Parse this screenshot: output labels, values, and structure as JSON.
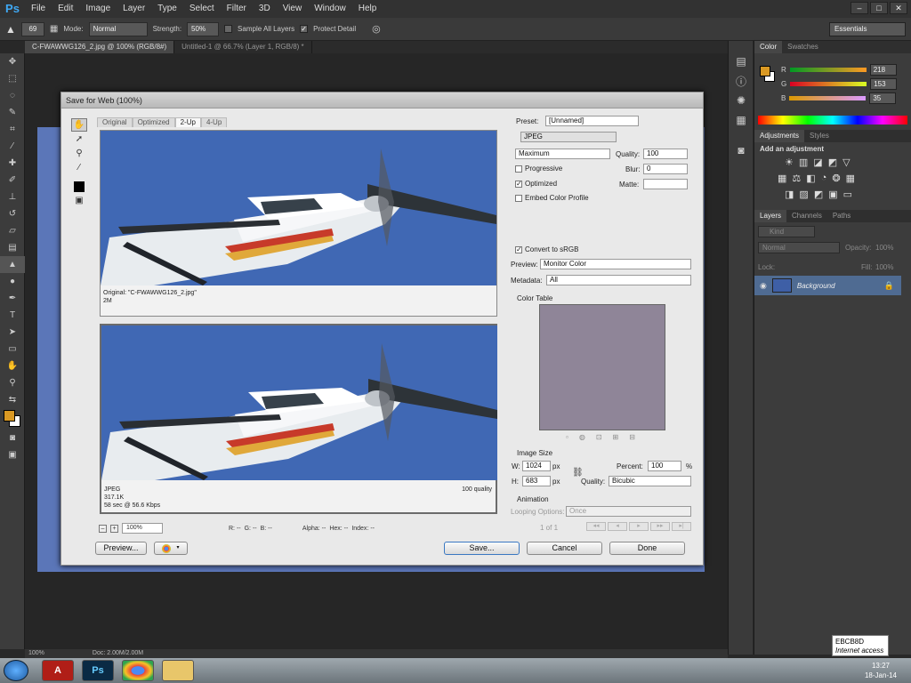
{
  "app": {
    "logo": "Ps"
  },
  "menu": [
    "File",
    "Edit",
    "Image",
    "Layer",
    "Type",
    "Select",
    "Filter",
    "3D",
    "View",
    "Window",
    "Help"
  ],
  "window_controls": [
    "–",
    "□",
    "✕"
  ],
  "options_bar": {
    "brush_size": "69",
    "mode_label": "Mode:",
    "mode_value": "Normal",
    "strength_label": "Strength:",
    "strength_value": "50%",
    "sample_all_layers": "Sample All Layers",
    "protect_detail": "Protect Detail",
    "workspace": "Essentials"
  },
  "doc_tabs": [
    {
      "label": "C-FWAWWG126_2.jpg @ 100% (RGB/8#)",
      "active": true
    },
    {
      "label": "Untitled-1 @ 66.7% (Layer 1, RGB/8) *",
      "active": false
    }
  ],
  "status_bar": {
    "zoom": "100%",
    "doc": "Doc: 2.00M/2.00M"
  },
  "color_panel": {
    "tabs": [
      "Color",
      "Swatches"
    ],
    "r_label": "R",
    "r_value": "218",
    "g_label": "G",
    "g_value": "153",
    "b_label": "B",
    "b_value": "35",
    "foreground_color": "#da9923"
  },
  "adjustments_panel": {
    "tabs": [
      "Adjustments",
      "Styles"
    ],
    "heading": "Add an adjustment"
  },
  "layers_panel": {
    "tabs": [
      "Layers",
      "Channels",
      "Paths"
    ],
    "kind": "Kind",
    "blend_mode": "Normal",
    "opacity_label": "Opacity:",
    "opacity_value": "100%",
    "lock_label": "Lock:",
    "fill_label": "Fill:",
    "fill_value": "100%",
    "layer_name": "Background"
  },
  "dialog": {
    "title": "Save for Web (100%)",
    "view_tabs": [
      "Original",
      "Optimized",
      "2-Up",
      "4-Up"
    ],
    "original_info": {
      "line1": "Original: \"C-FWAWWG126_2.jpg\"",
      "line2": "2M"
    },
    "optimized_info": {
      "format": "JPEG",
      "size": "317.1K",
      "time": "58 sec @ 56.6 Kbps",
      "quality": "100 quality"
    },
    "zoom": "100%",
    "readouts": {
      "r": "R: --",
      "g": "G: --",
      "b": "B: --",
      "alpha": "Alpha: --",
      "hex": "Hex: --",
      "index": "Index: --"
    },
    "preset_label": "Preset:",
    "preset_value": "[Unnamed]",
    "format_value": "JPEG",
    "compression_value": "Maximum",
    "quality_label": "Quality:",
    "quality_value": "100",
    "blur_label": "Blur:",
    "blur_value": "0",
    "matte_label": "Matte:",
    "progressive": "Progressive",
    "optimized": "Optimized",
    "embed_profile": "Embed Color Profile",
    "convert_srgb": "Convert to sRGB",
    "preview_label": "Preview:",
    "preview_value": "Monitor Color",
    "metadata_label": "Metadata:",
    "metadata_value": "All",
    "color_table_label": "Color Table",
    "image_size_label": "Image Size",
    "w_label": "W:",
    "w_value": "1024",
    "h_label": "H:",
    "h_value": "683",
    "px": "px",
    "percent_label": "Percent:",
    "percent_value": "100",
    "percent_unit": "%",
    "resample_label": "Quality:",
    "resample_value": "Bicubic",
    "animation_label": "Animation",
    "looping_label": "Looping Options:",
    "looping_value": "Once",
    "frame_counter": "1 of 1",
    "preview_btn": "Preview...",
    "save_btn": "Save...",
    "cancel_btn": "Cancel",
    "done_btn": "Done"
  },
  "tooltip": {
    "line1": "EBCB8D",
    "line2": "Internet access"
  },
  "clock": {
    "time": "13:27",
    "date": "18-Jan-14"
  }
}
